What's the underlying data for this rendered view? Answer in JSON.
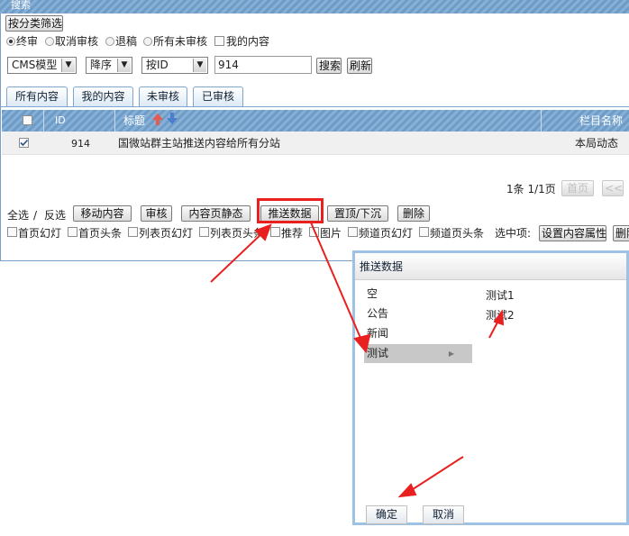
{
  "search": {
    "header_title": "搜索",
    "category_filter_button": "按分类筛选",
    "status_options": [
      {
        "label": "终审",
        "selected": true
      },
      {
        "label": "取消审核",
        "selected": false
      },
      {
        "label": "退稿",
        "selected": false
      },
      {
        "label": "所有未审核",
        "selected": false
      }
    ],
    "my_content_label": "我的内容",
    "model_select": "CMS模型",
    "order_select": "降序",
    "sort_select": "按ID",
    "query_value": "914",
    "search_button": "搜索",
    "refresh_button": "刷新"
  },
  "tabs": [
    "所有内容",
    "我的内容",
    "未审核",
    "已审核"
  ],
  "table": {
    "columns": [
      "ID",
      "标题",
      "栏目名称"
    ],
    "rows": [
      {
        "id": "914",
        "title": "国微站群主站推送内容给所有分站",
        "channel": "本局动态",
        "checked": true
      }
    ]
  },
  "pagination": {
    "summary": "1条 1/1页",
    "first_button": "首页",
    "prev_button": "<<"
  },
  "actions": {
    "select_all": "全选",
    "separator": "/",
    "invert": "反选",
    "move": "移动内容",
    "audit": "审核",
    "static_page": "内容页静态",
    "push": "推送数据",
    "top": "置顶/下沉",
    "delete": "删除"
  },
  "attributes": {
    "items": [
      "首页幻灯",
      "首页头条",
      "列表页幻灯",
      "列表页头条",
      "推荐",
      "图片",
      "频道页幻灯",
      "频道页头条"
    ],
    "selected_label": "选中项:",
    "set_button": "设置内容属性",
    "more_button": "删除"
  },
  "dialog": {
    "title": "推送数据",
    "menu": [
      "空",
      "公告",
      "新闻",
      "测试"
    ],
    "selected_menu": "测试",
    "submenu": [
      "测试1",
      "测试2"
    ],
    "ok_button": "确定",
    "cancel_button": "取消"
  },
  "colors": {
    "header_blue": "#7aa6d0",
    "annotation_red": "#e8201f",
    "dialog_border": "#9cc3e6"
  }
}
